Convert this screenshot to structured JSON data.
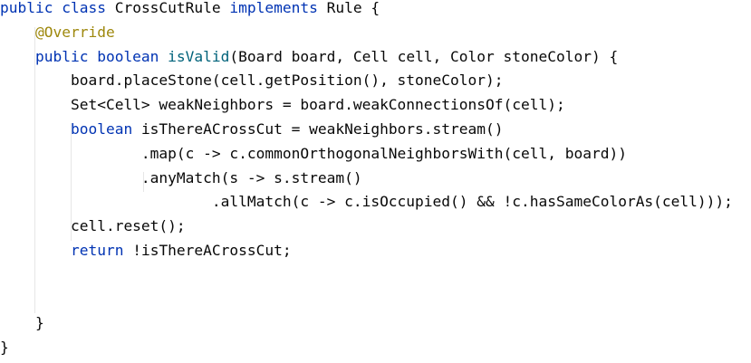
{
  "editor": {
    "lines": [
      {
        "tokens": [
          {
            "text": "public class ",
            "k": "kw"
          },
          {
            "text": "CrossCutRule "
          },
          {
            "text": "implements ",
            "k": "kw"
          },
          {
            "text": "Rule {"
          }
        ]
      },
      {
        "tokens": [
          {
            "text": "    "
          },
          {
            "text": "@Override",
            "k": "ann"
          }
        ]
      },
      {
        "tokens": [
          {
            "text": "    "
          },
          {
            "text": "public boolean ",
            "k": "kw"
          },
          {
            "text": "isValid",
            "k": "fn"
          },
          {
            "text": "(Board board, Cell cell, Color stoneColor) {"
          }
        ]
      },
      {
        "tokens": [
          {
            "text": "        board.placeStone(cell.getPosition(), stoneColor);"
          }
        ]
      },
      {
        "tokens": [
          {
            "text": "        Set<Cell> weakNeighbors = board.weakConnectionsOf(cell);"
          }
        ]
      },
      {
        "tokens": [
          {
            "text": "        "
          },
          {
            "text": "boolean ",
            "k": "kw"
          },
          {
            "text": "isThereACrossCut = weakNeighbors.stream()"
          }
        ]
      },
      {
        "tokens": [
          {
            "text": "                .map(c -> c.commonOrthogonalNeighborsWith(cell, board))"
          }
        ]
      },
      {
        "tokens": [
          {
            "text": "                .anyMatch(s -> s.stream()"
          }
        ]
      },
      {
        "tokens": [
          {
            "text": "                        .allMatch(c -> c.isOccupied() && !c.hasSameColorAs(cell)));"
          }
        ]
      },
      {
        "tokens": [
          {
            "text": "        cell.reset();"
          }
        ]
      },
      {
        "tokens": [
          {
            "text": "        "
          },
          {
            "text": "return ",
            "k": "kw"
          },
          {
            "text": "!isThereACrossCut;"
          }
        ]
      },
      {
        "tokens": []
      },
      {
        "tokens": []
      },
      {
        "tokens": [
          {
            "text": "    }"
          }
        ]
      },
      {
        "tokens": [
          {
            "text": "}"
          }
        ]
      }
    ]
  }
}
